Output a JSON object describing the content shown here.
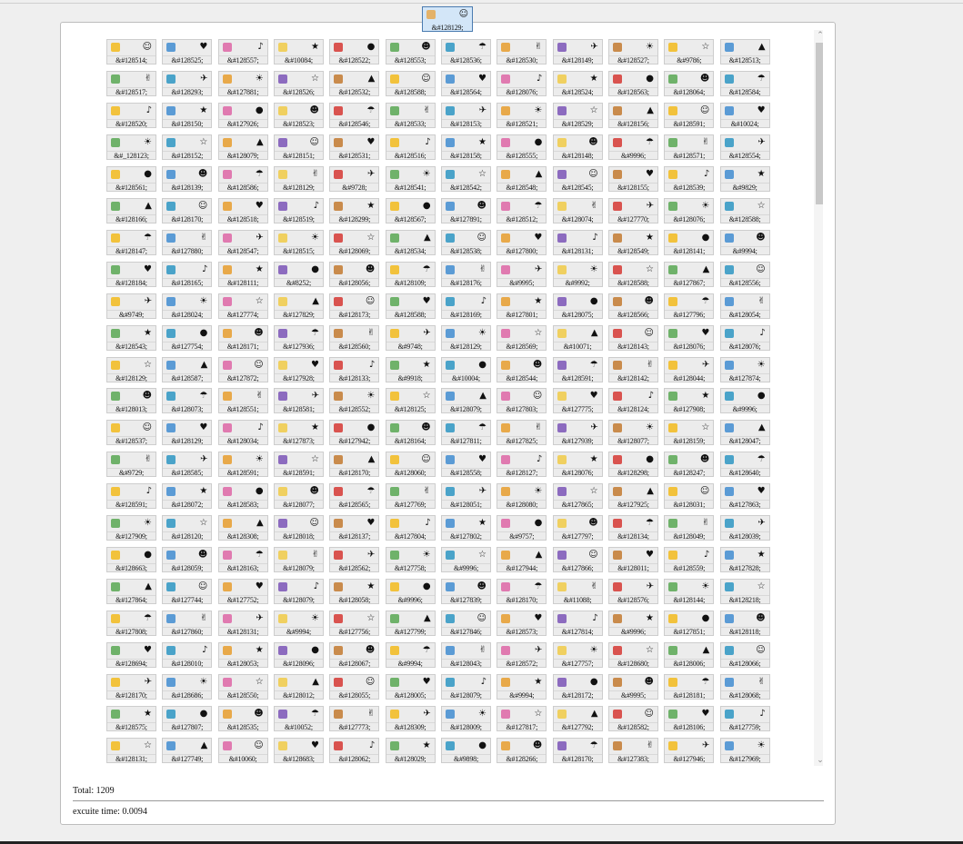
{
  "dragged_tile": {
    "label": "&#128129;"
  },
  "grid": {
    "rows": [
      [
        "&#128514;",
        "&#128525;",
        "&#128557;",
        "&#10084;",
        "&#128522;",
        "&#128553;",
        "&#128536;",
        "&#128530;",
        "&#128149;",
        "&#128527;",
        "&#9786;",
        "&#128513;"
      ],
      [
        "&#128517;",
        "&#128293;",
        "&#127881;",
        "&#128526;",
        "&#128532;",
        "&#128588;",
        "&#128564;",
        "&#128076;",
        "&#128524;",
        "&#128563;",
        "&#128064;",
        "&#128584;"
      ],
      [
        "&#128520;",
        "&#128150;",
        "&#127926;",
        "&#128523;",
        "&#128546;",
        "&#128533;",
        "&#128153;",
        "&#128521;",
        "&#128529;",
        "&#128156;",
        "&#128591;",
        "&#10024;"
      ],
      [
        "&#_128123;",
        "&#128152;",
        "&#128079;",
        "&#128151;",
        "&#128531;",
        "&#128516;",
        "&#128158;",
        "&#128555;",
        "&#128148;",
        "&#9996;",
        "&#128571;",
        "&#128554;"
      ],
      [
        "&#128561;",
        "&#128139;",
        "&#128586;",
        "&#128129;",
        "&#9728;",
        "&#128541;",
        "&#128542;",
        "&#128548;",
        "&#128545;",
        "&#128155;",
        "&#128539;",
        "&#9829;"
      ],
      [
        "&#128166;",
        "&#128170;",
        "&#128518;",
        "&#128519;",
        "&#128299;",
        "&#128567;",
        "&#127891;",
        "&#128512;",
        "&#128074;",
        "&#127770;",
        "&#128076;",
        "&#128588;"
      ],
      [
        "&#128147;",
        "&#127880;",
        "&#128547;",
        "&#128515;",
        "&#128069;",
        "&#128534;",
        "&#128538;",
        "&#127800;",
        "&#128131;",
        "&#128549;",
        "&#128141;",
        "&#9994;"
      ],
      [
        "&#128184;",
        "&#128165;",
        "&#128111;",
        "&#8252;",
        "&#128056;",
        "&#128109;",
        "&#128176;",
        "&#9995;",
        "&#9992;",
        "&#128588;",
        "&#127867;",
        "&#128556;"
      ],
      [
        "&#9749;",
        "&#128024;",
        "&#127774;",
        "&#127829;",
        "&#128173;",
        "&#128588;",
        "&#128169;",
        "&#127801;",
        "&#128075;",
        "&#128566;",
        "&#127796;",
        "&#128054;"
      ],
      [
        "&#128543;",
        "&#127754;",
        "&#128171;",
        "&#127936;",
        "&#128560;",
        "&#9748;",
        "&#128129;",
        "&#128569;",
        "&#10071;",
        "&#128143;",
        "&#128076;",
        "&#128076;"
      ],
      [
        "&#128129;",
        "&#128587;",
        "&#127872;",
        "&#127928;",
        "&#128133;",
        "&#9918;",
        "&#10004;",
        "&#128544;",
        "&#128591;",
        "&#128142;",
        "&#128044;",
        "&#127874;"
      ],
      [
        "&#128013;",
        "&#128073;",
        "&#128551;",
        "&#128581;",
        "&#128552;",
        "&#128125;",
        "&#128079;",
        "&#127803;",
        "&#127775;",
        "&#128124;",
        "&#127908;",
        "&#9996;"
      ],
      [
        "&#128537;",
        "&#128129;",
        "&#128034;",
        "&#127873;",
        "&#127942;",
        "&#128164;",
        "&#127811;",
        "&#127825;",
        "&#127939;",
        "&#128077;",
        "&#128159;",
        "&#128047;"
      ],
      [
        "&#9729;",
        "&#128585;",
        "&#128591;",
        "&#128591;",
        "&#128170;",
        "&#128060;",
        "&#128558;",
        "&#128127;",
        "&#128076;",
        "&#128298;",
        "&#128247;",
        "&#128640;"
      ],
      [
        "&#128591;",
        "&#128072;",
        "&#128583;",
        "&#128077;",
        "&#128565;",
        "&#127769;",
        "&#128051;",
        "&#128080;",
        "&#127865;",
        "&#127925;",
        "&#128031;",
        "&#127863;"
      ],
      [
        "&#127909;",
        "&#128120;",
        "&#128308;",
        "&#128018;",
        "&#128137;",
        "&#127804;",
        "&#127802;",
        "&#9757;",
        "&#127797;",
        "&#128134;",
        "&#128049;",
        "&#128039;"
      ],
      [
        "&#128663;",
        "&#128059;",
        "&#128163;",
        "&#128079;",
        "&#128562;",
        "&#127758;",
        "&#9996;",
        "&#127944;",
        "&#127866;",
        "&#128011;",
        "&#128559;",
        "&#127828;"
      ],
      [
        "&#127864;",
        "&#127744;",
        "&#127752;",
        "&#128079;",
        "&#128058;",
        "&#9996;",
        "&#127839;",
        "&#128170;",
        "&#11088;",
        "&#128576;",
        "&#128144;",
        "&#128218;"
      ],
      [
        "&#127808;",
        "&#127860;",
        "&#128131;",
        "&#9994;",
        "&#127756;",
        "&#127799;",
        "&#127846;",
        "&#128573;",
        "&#127814;",
        "&#9996;",
        "&#127851;",
        "&#128118;"
      ],
      [
        "&#128694;",
        "&#128010;",
        "&#128053;",
        "&#128096;",
        "&#128067;",
        "&#9994;",
        "&#128043;",
        "&#128572;",
        "&#127757;",
        "&#128680;",
        "&#128006;",
        "&#128066;"
      ],
      [
        "&#128170;",
        "&#128686;",
        "&#128550;",
        "&#128012;",
        "&#128055;",
        "&#128005;",
        "&#128079;",
        "&#9994;",
        "&#128172;",
        "&#9995;",
        "&#128181;",
        "&#128068;"
      ],
      [
        "&#128575;",
        "&#127807;",
        "&#128535;",
        "&#10052;",
        "&#127773;",
        "&#128309;",
        "&#128009;",
        "&#127817;",
        "&#127792;",
        "&#128582;",
        "&#128106;",
        "&#127759;"
      ],
      [
        "&#128131;",
        "&#127749;",
        "&#10060;",
        "&#128683;",
        "&#128062;",
        "&#128029;",
        "&#9898;",
        "&#128266;",
        "&#128170;",
        "&#127383;",
        "&#127946;",
        "&#127969;"
      ]
    ]
  },
  "footer": {
    "total": "Total: 1209",
    "exec_time": "excuite time: 0.0094"
  }
}
